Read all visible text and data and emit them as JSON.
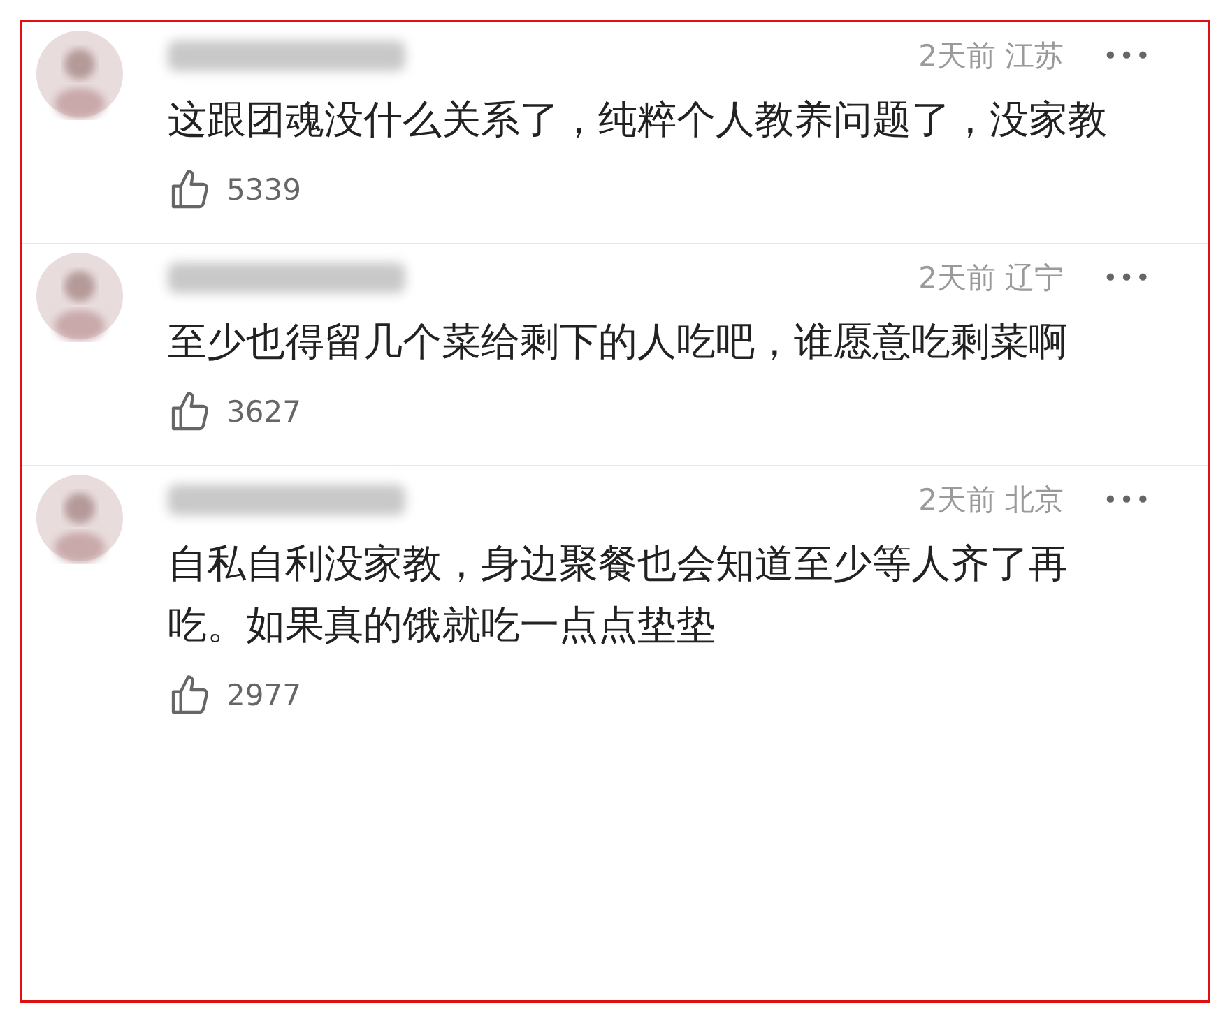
{
  "comments": [
    {
      "time": "2天前",
      "location": "江苏",
      "more": "•••",
      "text": "这跟团魂没什么关系了，纯粹个人教养问题了，没家教",
      "likes": "5339"
    },
    {
      "time": "2天前",
      "location": "辽宁",
      "more": "•••",
      "text": "至少也得留几个菜给剩下的人吃吧，谁愿意吃剩菜啊",
      "likes": "3627"
    },
    {
      "time": "2天前",
      "location": "北京",
      "more": "•••",
      "text": "自私自利没家教，身边聚餐也会知道至少等人齐了再吃。如果真的饿就吃一点点垫垫",
      "likes": "2977"
    }
  ]
}
